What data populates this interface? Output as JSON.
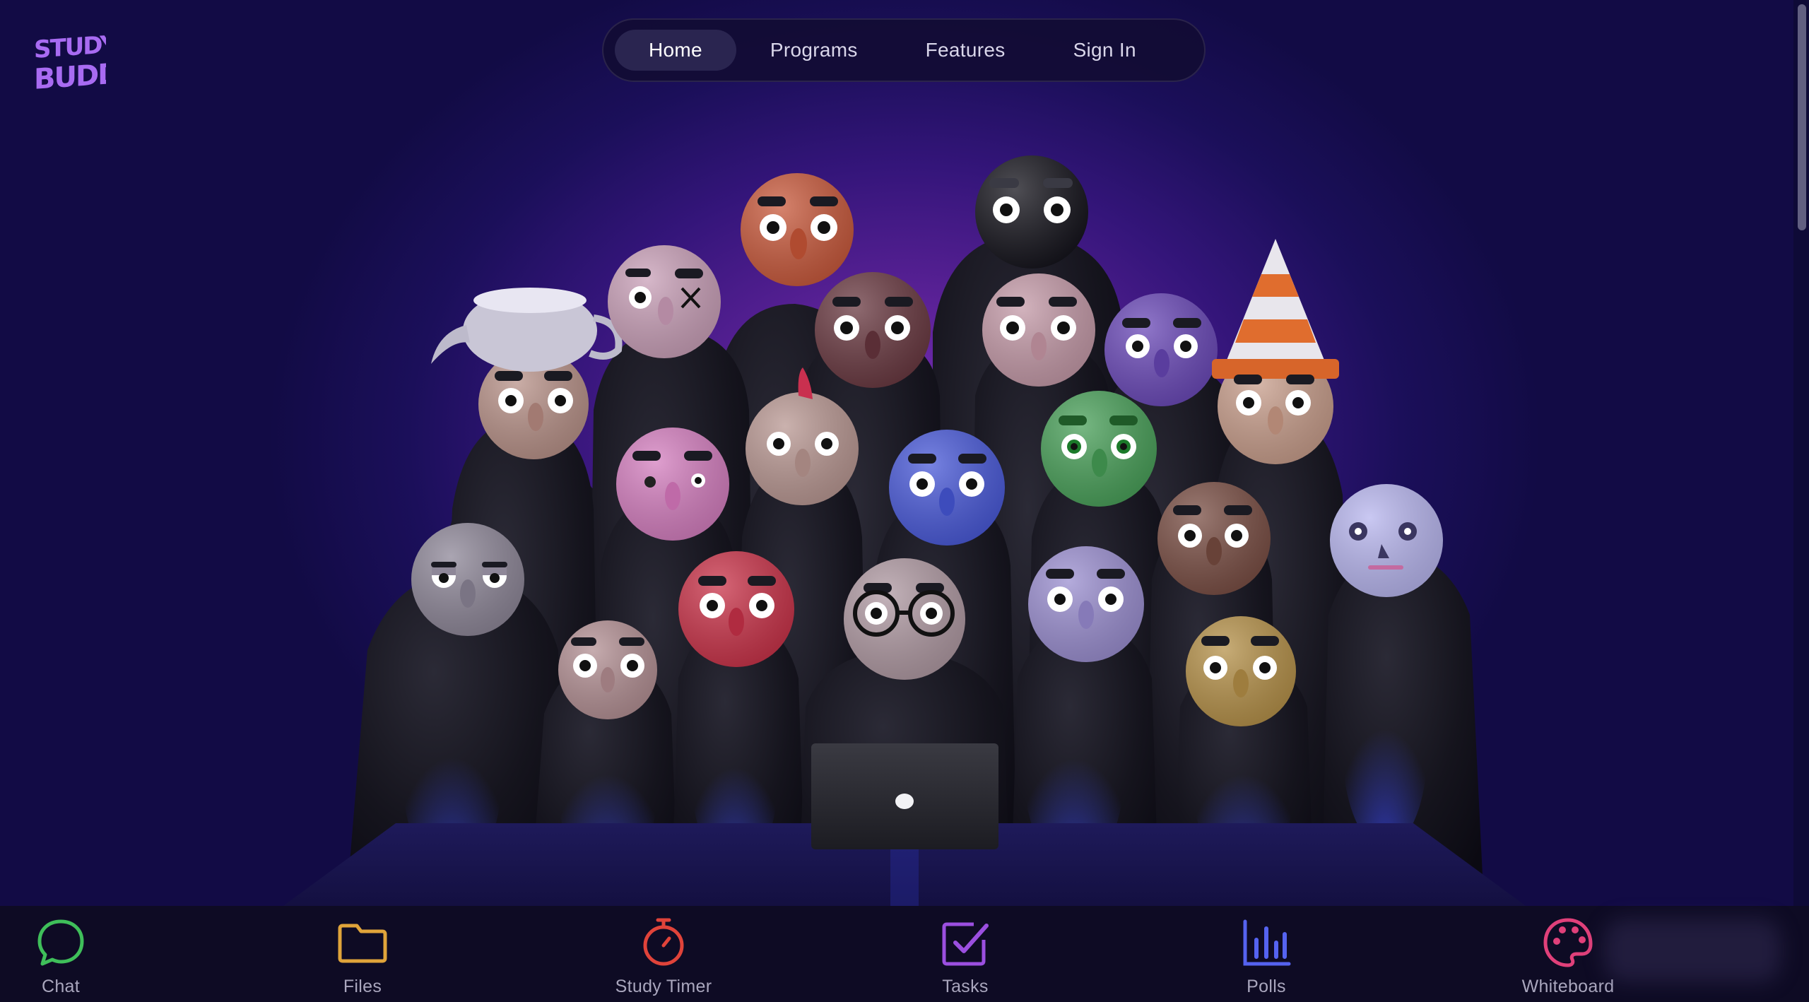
{
  "brand": {
    "logo_text": "STUDY BUDDY",
    "logo_color": "#a86bf2"
  },
  "nav": {
    "items": [
      {
        "label": "Home",
        "active": true
      },
      {
        "label": "Programs",
        "active": false
      },
      {
        "label": "Features",
        "active": false
      },
      {
        "label": "Sign In",
        "active": false
      }
    ]
  },
  "hero": {
    "image": "group of 3D cartoon student characters around a laptop"
  },
  "dock": {
    "items": [
      {
        "label": "Chat",
        "icon": "chat-bubble-icon",
        "color": "#3fbf5a"
      },
      {
        "label": "Files",
        "icon": "folder-icon",
        "color": "#e0a43a"
      },
      {
        "label": "Study Timer",
        "icon": "stopwatch-icon",
        "color": "#e0433a"
      },
      {
        "label": "Tasks",
        "icon": "checkbox-icon",
        "color": "#9b4fe0"
      },
      {
        "label": "Polls",
        "icon": "bar-chart-icon",
        "color": "#5563f0"
      },
      {
        "label": "Whiteboard",
        "icon": "palette-icon",
        "color": "#e0407a"
      }
    ]
  }
}
